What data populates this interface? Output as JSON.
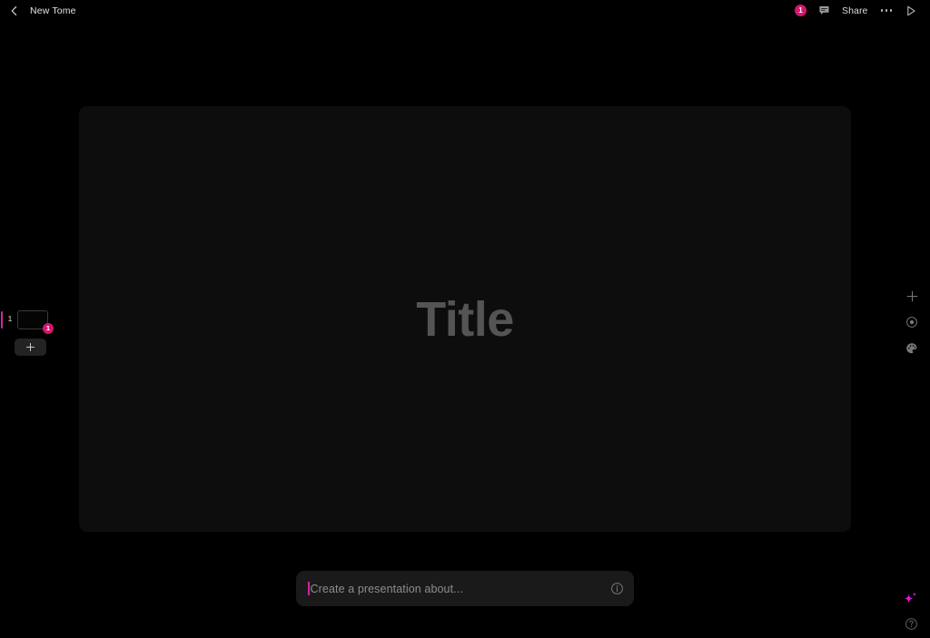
{
  "app": {
    "background_color": "#000000",
    "accent_color": "#cc27a4",
    "badge_color": "#d4176b"
  },
  "topbar": {
    "back_icon": "chevron-left-icon",
    "title": "New Tome",
    "notification_badge": "1",
    "comment_icon": "comment-bubble-icon",
    "share_label": "Share",
    "more_icon": "ellipsis-icon",
    "present_icon": "play-icon"
  },
  "slide_rail": {
    "slides": [
      {
        "number": "1",
        "selected": true,
        "badge": "1"
      }
    ],
    "add_slide_icon": "plus-icon"
  },
  "canvas": {
    "title_placeholder": "Title"
  },
  "prompt": {
    "placeholder": "Create a presentation about...",
    "info_icon": "info-circle-icon"
  },
  "right_rail": {
    "items": [
      {
        "icon": "plus-icon",
        "label": "Add block"
      },
      {
        "icon": "record-circle-icon",
        "label": "Record"
      },
      {
        "icon": "palette-icon",
        "label": "Theme"
      }
    ]
  },
  "floating": {
    "ai_icon": "sparkle-icon",
    "help_icon": "help-circle-icon"
  }
}
